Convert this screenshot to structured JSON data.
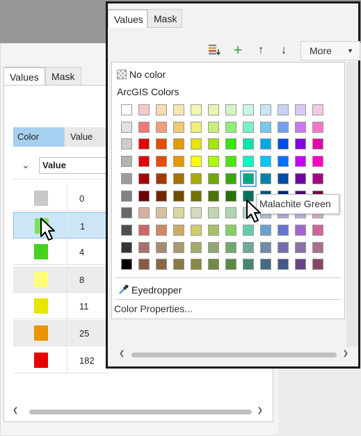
{
  "back_panel": {
    "tabs": [
      "Values",
      "Mask"
    ],
    "columns": {
      "color": "Color",
      "value": "Value"
    },
    "group_field": "Value",
    "rows": [
      {
        "color": "#c8c8c8",
        "value": "0"
      },
      {
        "color": "#7ee05a",
        "value": "1"
      },
      {
        "color": "#45d21f",
        "value": "4"
      },
      {
        "color": "#ffff7a",
        "value": "8"
      },
      {
        "color": "#e6e600",
        "value": "11"
      },
      {
        "color": "#e89500",
        "value": "25"
      },
      {
        "color": "#e80000",
        "value": "182"
      }
    ]
  },
  "popup": {
    "tabs": [
      "Values",
      "Mask"
    ],
    "toolbar": {
      "icons": [
        "add-classes-icon",
        "add-icon",
        "move-up-icon",
        "move-down-icon"
      ],
      "more_label": "More"
    },
    "no_color_label": "No color",
    "palette_title": "ArcGIS Colors",
    "eyedropper_label": "Eyedropper",
    "color_properties_label": "Color Properties...",
    "tooltip": "Malachite Green",
    "highlighted_swatch": "#00a884",
    "swatches": [
      [
        "#ffffff",
        "#f6c8c8",
        "#f5dcb4",
        "#f5e6b4",
        "#f5f5b4",
        "#e6f5b4",
        "#d2f5c8",
        "#c8f5e6",
        "#c8e6f5",
        "#c8d2f5",
        "#dcc8f5",
        "#f5c8e6"
      ],
      [
        "#e1e1e1",
        "#f07878",
        "#f0a078",
        "#f0c878",
        "#f0f078",
        "#c8f078",
        "#8cf078",
        "#78f0c8",
        "#78c8f0",
        "#789ef0",
        "#c878f0",
        "#f078c8"
      ],
      [
        "#cccccc",
        "#e60000",
        "#e64c00",
        "#e69800",
        "#e6e600",
        "#a3e600",
        "#38e600",
        "#00e6a9",
        "#00a9e6",
        "#004ce6",
        "#8400e6",
        "#e600a9"
      ],
      [
        "#b2b2b2",
        "#e60000",
        "#e64c00",
        "#e69800",
        "#ffff00",
        "#aaff00",
        "#4ce600",
        "#00ffc5",
        "#00c5ff",
        "#0070ff",
        "#c500ff",
        "#ff00c5"
      ],
      [
        "#9c9c9c",
        "#a80000",
        "#a83800",
        "#a87000",
        "#a8a800",
        "#70a800",
        "#38a800",
        "#00a884",
        "#0084a8",
        "#004da8",
        "#7300a8",
        "#a80084"
      ],
      [
        "#828282",
        "#730000",
        "#732600",
        "#734c00",
        "#737300",
        "#4c7300",
        "#267300",
        "#00735a",
        "#005a73",
        "#002673",
        "#4c0073",
        "#73004c"
      ],
      [
        "#686868",
        "#d7b09e",
        "#d7c29e",
        "#d7d79e",
        "#d7d7c2",
        "#c2d7b0",
        "#b0d7b0",
        "#b0d7c2",
        "#b0c2d7",
        "#b0b0d7",
        "#c2b0d7",
        "#d7b0c2"
      ],
      [
        "#4e4e4e",
        "#cd6666",
        "#cd8966",
        "#cdaa66",
        "#cdcd66",
        "#a5c266",
        "#89cd66",
        "#66cdab",
        "#66a3cd",
        "#6677cd",
        "#a366cd",
        "#cd6699"
      ],
      [
        "#343434",
        "#a87171",
        "#a88a71",
        "#a89b71",
        "#a8a871",
        "#8ea871",
        "#71a871",
        "#71a89b",
        "#718aa8",
        "#7171a8",
        "#8a71a8",
        "#a8718a"
      ],
      [
        "#000000",
        "#895a44",
        "#896944",
        "#897944",
        "#898944",
        "#738944",
        "#5a8944",
        "#448970",
        "#446989",
        "#445a89",
        "#694489",
        "#894469"
      ]
    ]
  }
}
